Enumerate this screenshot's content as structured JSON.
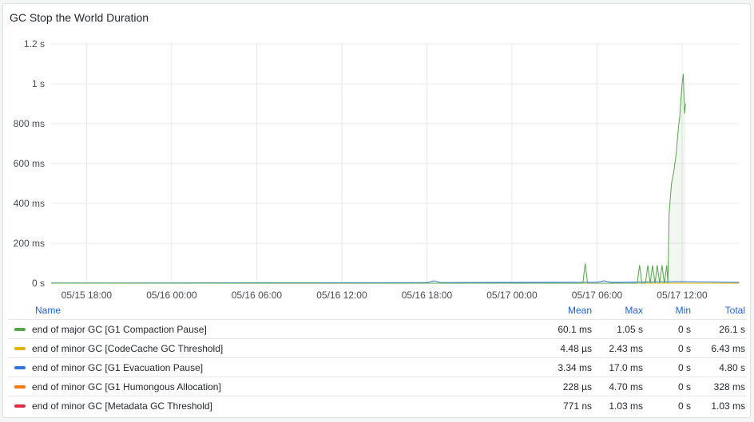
{
  "panel": {
    "title": "GC Stop the World Duration"
  },
  "chart_data": {
    "type": "line",
    "title": "GC Stop the World Duration",
    "xlabel": "",
    "ylabel": "",
    "y_unit": "ms",
    "ylim": [
      0,
      1200
    ],
    "yticks": [
      {
        "value": 0,
        "label": "0 s"
      },
      {
        "value": 200,
        "label": "200 ms"
      },
      {
        "value": 400,
        "label": "400 ms"
      },
      {
        "value": 600,
        "label": "600 ms"
      },
      {
        "value": 800,
        "label": "800 ms"
      },
      {
        "value": 1000,
        "label": "1 s"
      },
      {
        "value": 1200,
        "label": "1.2 s"
      }
    ],
    "xlim": [
      "05/15 15:30",
      "05/17 16:00"
    ],
    "xticks": [
      "05/15 18:00",
      "05/16 00:00",
      "05/16 06:00",
      "05/16 12:00",
      "05/16 18:00",
      "05/17 00:00",
      "05/17 06:00",
      "05/17 12:00"
    ],
    "grid": true,
    "legend_placement": "bottom-table",
    "series": [
      {
        "name": "end of major GC [G1 Compaction Pause]",
        "color": "#56a64b",
        "points": [
          [
            "05/15 15:30",
            0
          ],
          [
            "05/17 05:00",
            0
          ],
          [
            "05/17 05:10",
            100
          ],
          [
            "05/17 05:20",
            0
          ],
          [
            "05/17 08:50",
            0
          ],
          [
            "05/17 09:00",
            90
          ],
          [
            "05/17 09:10",
            0
          ],
          [
            "05/17 09:25",
            0
          ],
          [
            "05/17 09:35",
            90
          ],
          [
            "05/17 09:45",
            0
          ],
          [
            "05/17 09:55",
            90
          ],
          [
            "05/17 10:05",
            0
          ],
          [
            "05/17 10:15",
            90
          ],
          [
            "05/17 10:25",
            0
          ],
          [
            "05/17 10:35",
            90
          ],
          [
            "05/17 10:45",
            0
          ],
          [
            "05/17 10:55",
            90
          ],
          [
            "05/17 11:00",
            0
          ],
          [
            "05/17 11:05",
            350
          ],
          [
            "05/17 11:15",
            500
          ],
          [
            "05/17 11:25",
            560
          ],
          [
            "05/17 11:35",
            650
          ],
          [
            "05/17 11:40",
            720
          ],
          [
            "05/17 11:45",
            790
          ],
          [
            "05/17 11:50",
            830
          ],
          [
            "05/17 11:55",
            920
          ],
          [
            "05/17 12:00",
            1000
          ],
          [
            "05/17 12:05",
            1050
          ],
          [
            "05/17 12:10",
            850
          ],
          [
            "05/17 12:15",
            900
          ]
        ]
      },
      {
        "name": "end of minor GC [CodeCache GC Threshold]",
        "color": "#e0b400",
        "points": [
          [
            "05/15 15:30",
            0
          ],
          [
            "05/17 16:00",
            0
          ]
        ]
      },
      {
        "name": "end of minor GC [G1 Evacuation Pause]",
        "color": "#3274d9",
        "points": [
          [
            "05/15 15:30",
            1
          ],
          [
            "05/16 06:00",
            2
          ],
          [
            "05/16 18:00",
            3
          ],
          [
            "05/16 18:30",
            12
          ],
          [
            "05/16 19:00",
            3
          ],
          [
            "05/17 00:00",
            4
          ],
          [
            "05/17 06:00",
            5
          ],
          [
            "05/17 06:30",
            12
          ],
          [
            "05/17 07:00",
            4
          ],
          [
            "05/17 12:00",
            8
          ],
          [
            "05/17 16:00",
            4
          ]
        ]
      },
      {
        "name": "end of minor GC [G1 Humongous Allocation]",
        "color": "#ff780a",
        "points": [
          [
            "05/15 15:30",
            0
          ],
          [
            "05/17 16:00",
            0
          ]
        ]
      },
      {
        "name": "end of minor GC [Metadata GC Threshold]",
        "color": "#e02f44",
        "points": [
          [
            "05/15 15:30",
            0
          ],
          [
            "05/17 16:00",
            0
          ]
        ]
      }
    ]
  },
  "legend": {
    "headers": {
      "name": "Name",
      "mean": "Mean",
      "max": "Max",
      "min": "Min",
      "total": "Total"
    },
    "rows": [
      {
        "name": "end of major GC [G1 Compaction Pause]",
        "color": "#56a64b",
        "mean": "60.1 ms",
        "max": "1.05 s",
        "min": "0 s",
        "total": "26.1 s"
      },
      {
        "name": "end of minor GC [CodeCache GC Threshold]",
        "color": "#e0b400",
        "mean": "4.48 µs",
        "max": "2.43 ms",
        "min": "0 s",
        "total": "6.43 ms"
      },
      {
        "name": "end of minor GC [G1 Evacuation Pause]",
        "color": "#3274d9",
        "mean": "3.34 ms",
        "max": "17.0 ms",
        "min": "0 s",
        "total": "4.80 s"
      },
      {
        "name": "end of minor GC [G1 Humongous Allocation]",
        "color": "#ff780a",
        "mean": "228 µs",
        "max": "4.70 ms",
        "min": "0 s",
        "total": "328 ms"
      },
      {
        "name": "end of minor GC [Metadata GC Threshold]",
        "color": "#e02f44",
        "mean": "771 ns",
        "max": "1.03 ms",
        "min": "0 s",
        "total": "1.03 ms"
      }
    ]
  }
}
